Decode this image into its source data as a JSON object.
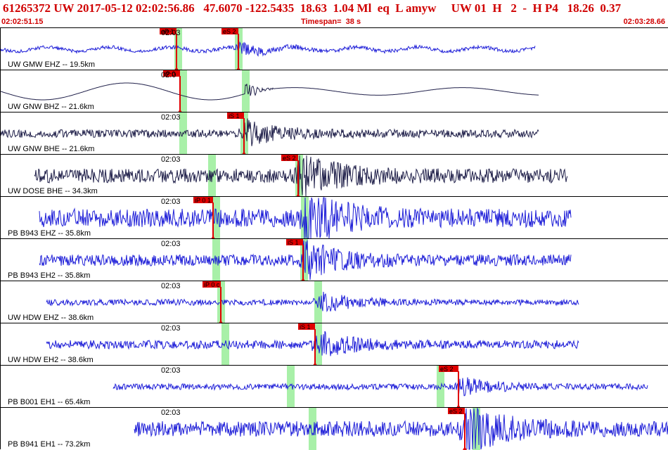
{
  "header": {
    "title": "61265372 UW 2017-05-12 02:02:56.86   47.6070 -122.5435  18.63  1.04 Ml  eq  L amyw     UW 01  H   2  -  H P4   18.26  0.37",
    "start_time": "02:02:51.15",
    "timespan": "Timespan=  38 s",
    "end_time": "02:03:28.66"
  },
  "colors": {
    "trace": "#1f1fd8",
    "trace_dark": "#20204a",
    "pick": "#e00000",
    "window": "#a8f0a8",
    "text_red": "#d00000"
  },
  "traces": [
    {
      "label": "UW GMW EHZ -- 19.5km",
      "time_label": "02:03",
      "picks": [
        "eP 1",
        "eS 2"
      ]
    },
    {
      "label": "UW GNW BHZ -- 21.6km",
      "time_label": "02:0",
      "picks": [
        "iP 0"
      ]
    },
    {
      "label": "UW GNW BHE -- 21.6km",
      "time_label": "02:03",
      "picks": [
        "iS 1"
      ]
    },
    {
      "label": "UW DOSE BHE -- 34.3km",
      "time_label": "02:03",
      "picks": [
        "eS 2"
      ]
    },
    {
      "label": "PB B943 EHZ -- 35.8km",
      "time_label": "02:03",
      "picks": [
        "iP 0 1"
      ]
    },
    {
      "label": "PB B943 EH2 -- 35.8km",
      "time_label": "02:03",
      "picks": [
        "iS 1"
      ]
    },
    {
      "label": "UW HDW EHZ -- 38.6km",
      "time_label": "02:03",
      "picks": [
        "iP 0 c"
      ]
    },
    {
      "label": "UW HDW EH2 -- 38.6km",
      "time_label": "02:03",
      "picks": [
        "iS 1"
      ]
    },
    {
      "label": "PB B001 EH1 -- 65.4km",
      "time_label": "02:03",
      "picks": [
        "eS 2"
      ]
    },
    {
      "label": "PB B941 EH1 -- 73.2km",
      "time_label": "02:03",
      "picks": [
        "eS 2"
      ]
    }
  ]
}
